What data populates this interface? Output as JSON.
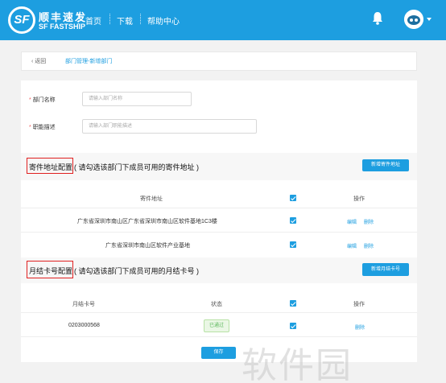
{
  "header": {
    "logo_mark": "SF",
    "logo_cn": "顺丰速发",
    "logo_en": "SF FASTSHIP",
    "nav": [
      "首页",
      "下载",
      "帮助中心"
    ]
  },
  "breadcrumb": {
    "back": "‹ 返回",
    "path": "部门管理-新增部门"
  },
  "form": {
    "name_label": "部门名称",
    "name_placeholder": "请输入部门名称",
    "desc_label": "职能描述",
    "desc_placeholder": "请输入部门职能描述",
    "required_mark": "*"
  },
  "address_section": {
    "title": "寄件地址配置",
    "hint": "( 请勾选该部门下成员可用的寄件地址 )",
    "add_button": "新增寄件地址",
    "columns": [
      "寄件地址",
      "操作"
    ],
    "rows": [
      {
        "address": "广东省深圳市南山区广东省深圳市南山区软件基地1C3楼",
        "edit": "编辑",
        "delete": "删除"
      },
      {
        "address": "广东省深圳市南山区软件产业基地",
        "edit": "编辑",
        "delete": "删除"
      }
    ]
  },
  "card_section": {
    "title": "月结卡号配置",
    "hint": "( 请勾选该部门下成员可用的月结卡号 )",
    "add_button": "新增月结卡号",
    "columns": [
      "月结卡号",
      "状态",
      "操作"
    ],
    "rows": [
      {
        "card": "0203000568",
        "status": "已通过",
        "delete": "删除"
      }
    ]
  },
  "save_button": "保存",
  "watermark": "软件园",
  "colors": {
    "primary": "#1d9ee0",
    "highlight_box": "#e02020",
    "status_green": "#5cb85c"
  }
}
